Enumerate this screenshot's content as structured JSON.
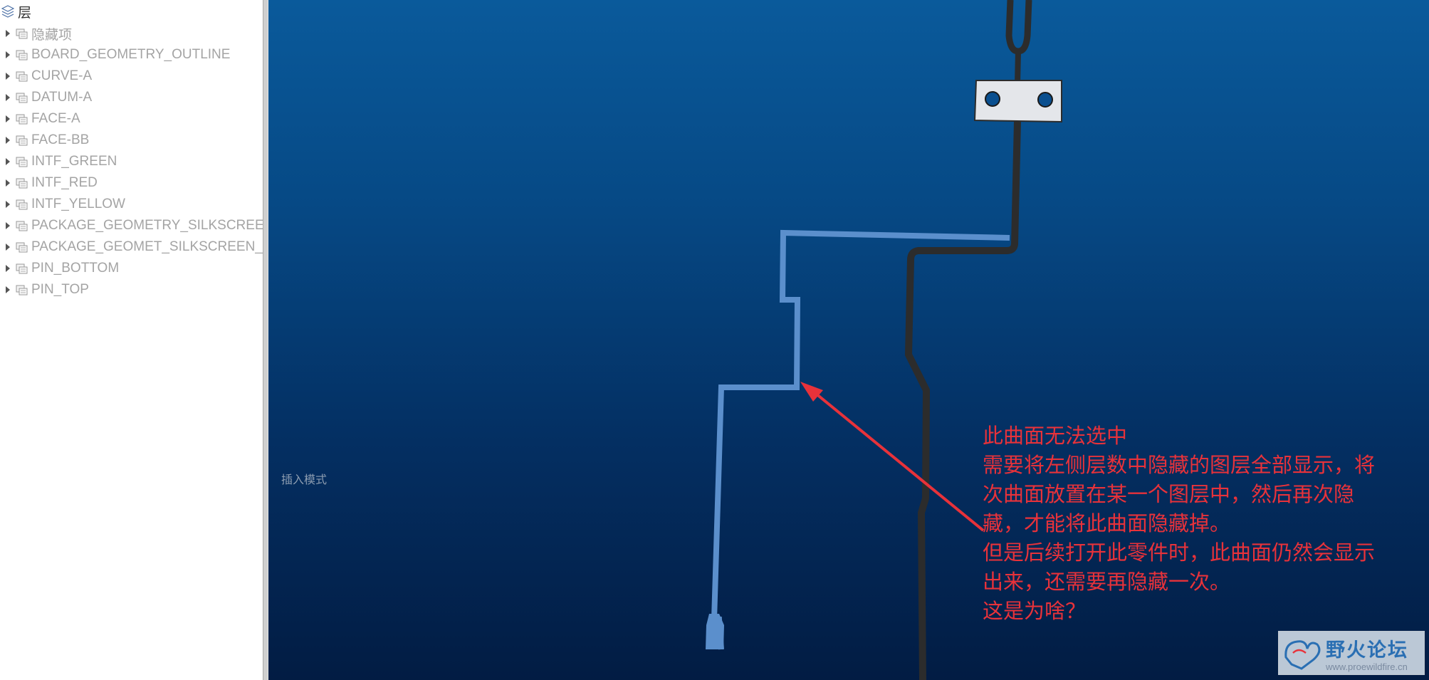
{
  "layer_panel": {
    "title": "层",
    "items": [
      {
        "label": "隐藏项"
      },
      {
        "label": "BOARD_GEOMETRY_OUTLINE"
      },
      {
        "label": "CURVE-A"
      },
      {
        "label": "DATUM-A"
      },
      {
        "label": "FACE-A"
      },
      {
        "label": "FACE-BB"
      },
      {
        "label": "INTF_GREEN"
      },
      {
        "label": "INTF_RED"
      },
      {
        "label": "INTF_YELLOW"
      },
      {
        "label": "PACKAGE_GEOMETRY_SILKSCREEN"
      },
      {
        "label": "PACKAGE_GEOMET_SILKSCREEN_B"
      },
      {
        "label": "PIN_BOTTOM"
      },
      {
        "label": "PIN_TOP"
      }
    ]
  },
  "viewport": {
    "mode_text": "插入模式",
    "annotation_lines": [
      "此曲面无法选中",
      "需要将左侧层数中隐藏的图层全部显示，将",
      "次曲面放置在某一个图层中，然后再次隐",
      "藏，才能将此曲面隐藏掉。",
      "但是后续打开此零件时，此曲面仍然会显示",
      "出来，还需要再隐藏一次。",
      "这是为啥？"
    ]
  },
  "watermark": {
    "title": "野火论坛",
    "url": "www.proewildfire.cn"
  },
  "colors": {
    "viewport_top": "#0a5a9b",
    "viewport_bottom": "#021c43",
    "highlight_surface": "#5b8fcc",
    "trace": "#2c2c2c",
    "annotation": "#e8323a",
    "layer_label": "#a4a4a4"
  }
}
